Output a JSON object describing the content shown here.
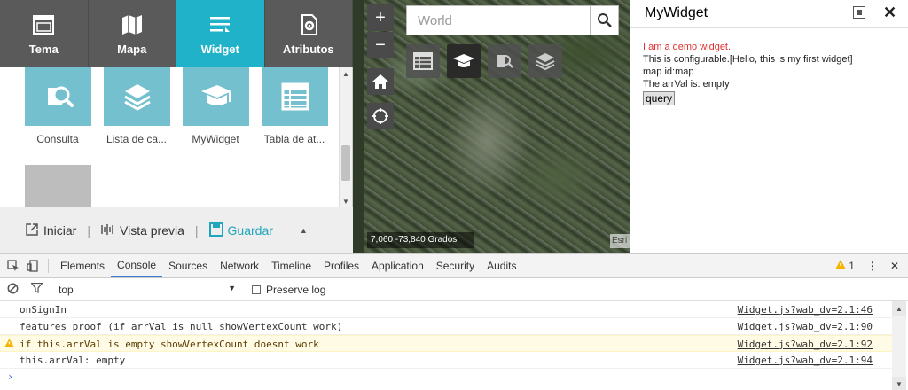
{
  "builder": {
    "tabs": [
      {
        "label": "Tema",
        "icon": "window-icon"
      },
      {
        "label": "Mapa",
        "icon": "map-icon"
      },
      {
        "label": "Widget",
        "icon": "widget-list-icon"
      },
      {
        "label": "Atributos",
        "icon": "gear-doc-icon"
      }
    ],
    "active_tab": "Widget",
    "widgets": [
      {
        "label": "Consulta",
        "icon": "query-search-icon"
      },
      {
        "label": "Lista de ca...",
        "icon": "layers-icon"
      },
      {
        "label": "MyWidget",
        "icon": "graduation-cap-icon"
      },
      {
        "label": "Tabla de at...",
        "icon": "table-icon"
      }
    ],
    "placeholder_tile": "1",
    "footer": {
      "start_label": "Iniciar",
      "preview_label": "Vista previa",
      "save_label": "Guardar"
    }
  },
  "map": {
    "search_placeholder": "World",
    "zoom_in": "+",
    "zoom_out": "−",
    "coords": "7,060 -73,840 Grados",
    "attribution": "Esri"
  },
  "widget_panel": {
    "title": "MyWidget",
    "line1": "I am a demo widget.",
    "line2": "This is configurable.[Hello, this is my first widget]",
    "line3": "map id:map",
    "line4": "The arrVal is: empty",
    "button": "query"
  },
  "devtools": {
    "tabs": [
      "Elements",
      "Console",
      "Sources",
      "Network",
      "Timeline",
      "Profiles",
      "Application",
      "Security",
      "Audits"
    ],
    "active_tab": "Console",
    "warn_count": "1",
    "context": "top",
    "preserve_log": "Preserve log",
    "messages": [
      {
        "text": "onSignIn",
        "source": "Widget.js?wab_dv=2.1:46",
        "level": "log"
      },
      {
        "text": "features proof (if arrVal is null showVertexCount work)",
        "source": "Widget.js?wab_dv=2.1:90",
        "level": "log"
      },
      {
        "text": "if this.arrVal is empty showVertexCount doesnt work",
        "source": "Widget.js?wab_dv=2.1:92",
        "level": "warn"
      },
      {
        "text": "this.arrVal: empty",
        "source": "Widget.js?wab_dv=2.1:94",
        "level": "log"
      }
    ],
    "prompt": "›"
  },
  "colors": {
    "active_tab": "#20b2c8",
    "tab_bar": "#5a5a5a",
    "tile": "#74c0cf",
    "devtools_accent": "#3879d9"
  }
}
